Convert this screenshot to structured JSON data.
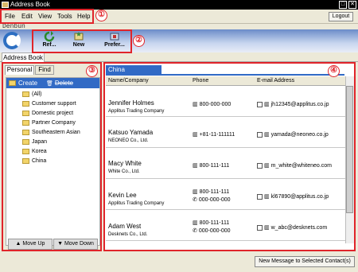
{
  "window": {
    "title": "Address Book"
  },
  "menu": {
    "items": [
      "File",
      "Edit",
      "View",
      "Tools",
      "Help"
    ],
    "logout_label": "Logout"
  },
  "brand": {
    "name": "Denbun"
  },
  "toolbar": {
    "refresh_label": "Ref...",
    "new_label": "New",
    "prefer_label": "Prefer..."
  },
  "tabs": {
    "address_book": "Address Book"
  },
  "left": {
    "subtabs": [
      "Personal",
      "Find"
    ],
    "create_label": "Create",
    "delete_label": "Delete",
    "folders": [
      "(All)",
      "Customer support",
      "Domestic project",
      "Partner Company",
      "Southeastern Asian",
      "Japan",
      "Korea",
      "China"
    ],
    "move_up_label": "Move Up",
    "move_down_label": "Move Down"
  },
  "right": {
    "group_tab": "China",
    "columns": [
      "Name/Company",
      "Phone",
      "E-mail Address"
    ],
    "contacts": [
      {
        "name": "Jennifer Holmes",
        "company": "Applitus Trading Company",
        "phone": "800-000-000",
        "phone2": "",
        "email": "jh12345@applitus.co.jp"
      },
      {
        "name": "Katsuo Yamada",
        "company": "NEONEO Co., Ltd.",
        "phone": "+81-11-111111",
        "phone2": "",
        "email": "yamada@neoneo.co.jp"
      },
      {
        "name": "Macy White",
        "company": "White Co., Ltd.",
        "phone": "800-111-111",
        "phone2": "",
        "email": "m_white@whiteneo.com"
      },
      {
        "name": "Kevin Lee",
        "company": "Applitus Trading Company",
        "phone": "800-111-111",
        "phone2": "000-000-000",
        "email": "kl67890@applitus.co.jp"
      },
      {
        "name": "Adam West",
        "company": "Desknets Co., Ltd.",
        "phone": "800-111-111",
        "phone2": "000-000-000",
        "email": "w_abc@desknets.com"
      }
    ]
  },
  "footer": {
    "new_message_label": "New Message to Selected Contact(s)"
  },
  "callouts": [
    "①",
    "②",
    "③",
    "④"
  ],
  "colors": {
    "accent": "#316ac5",
    "callout": "#e0242a"
  }
}
